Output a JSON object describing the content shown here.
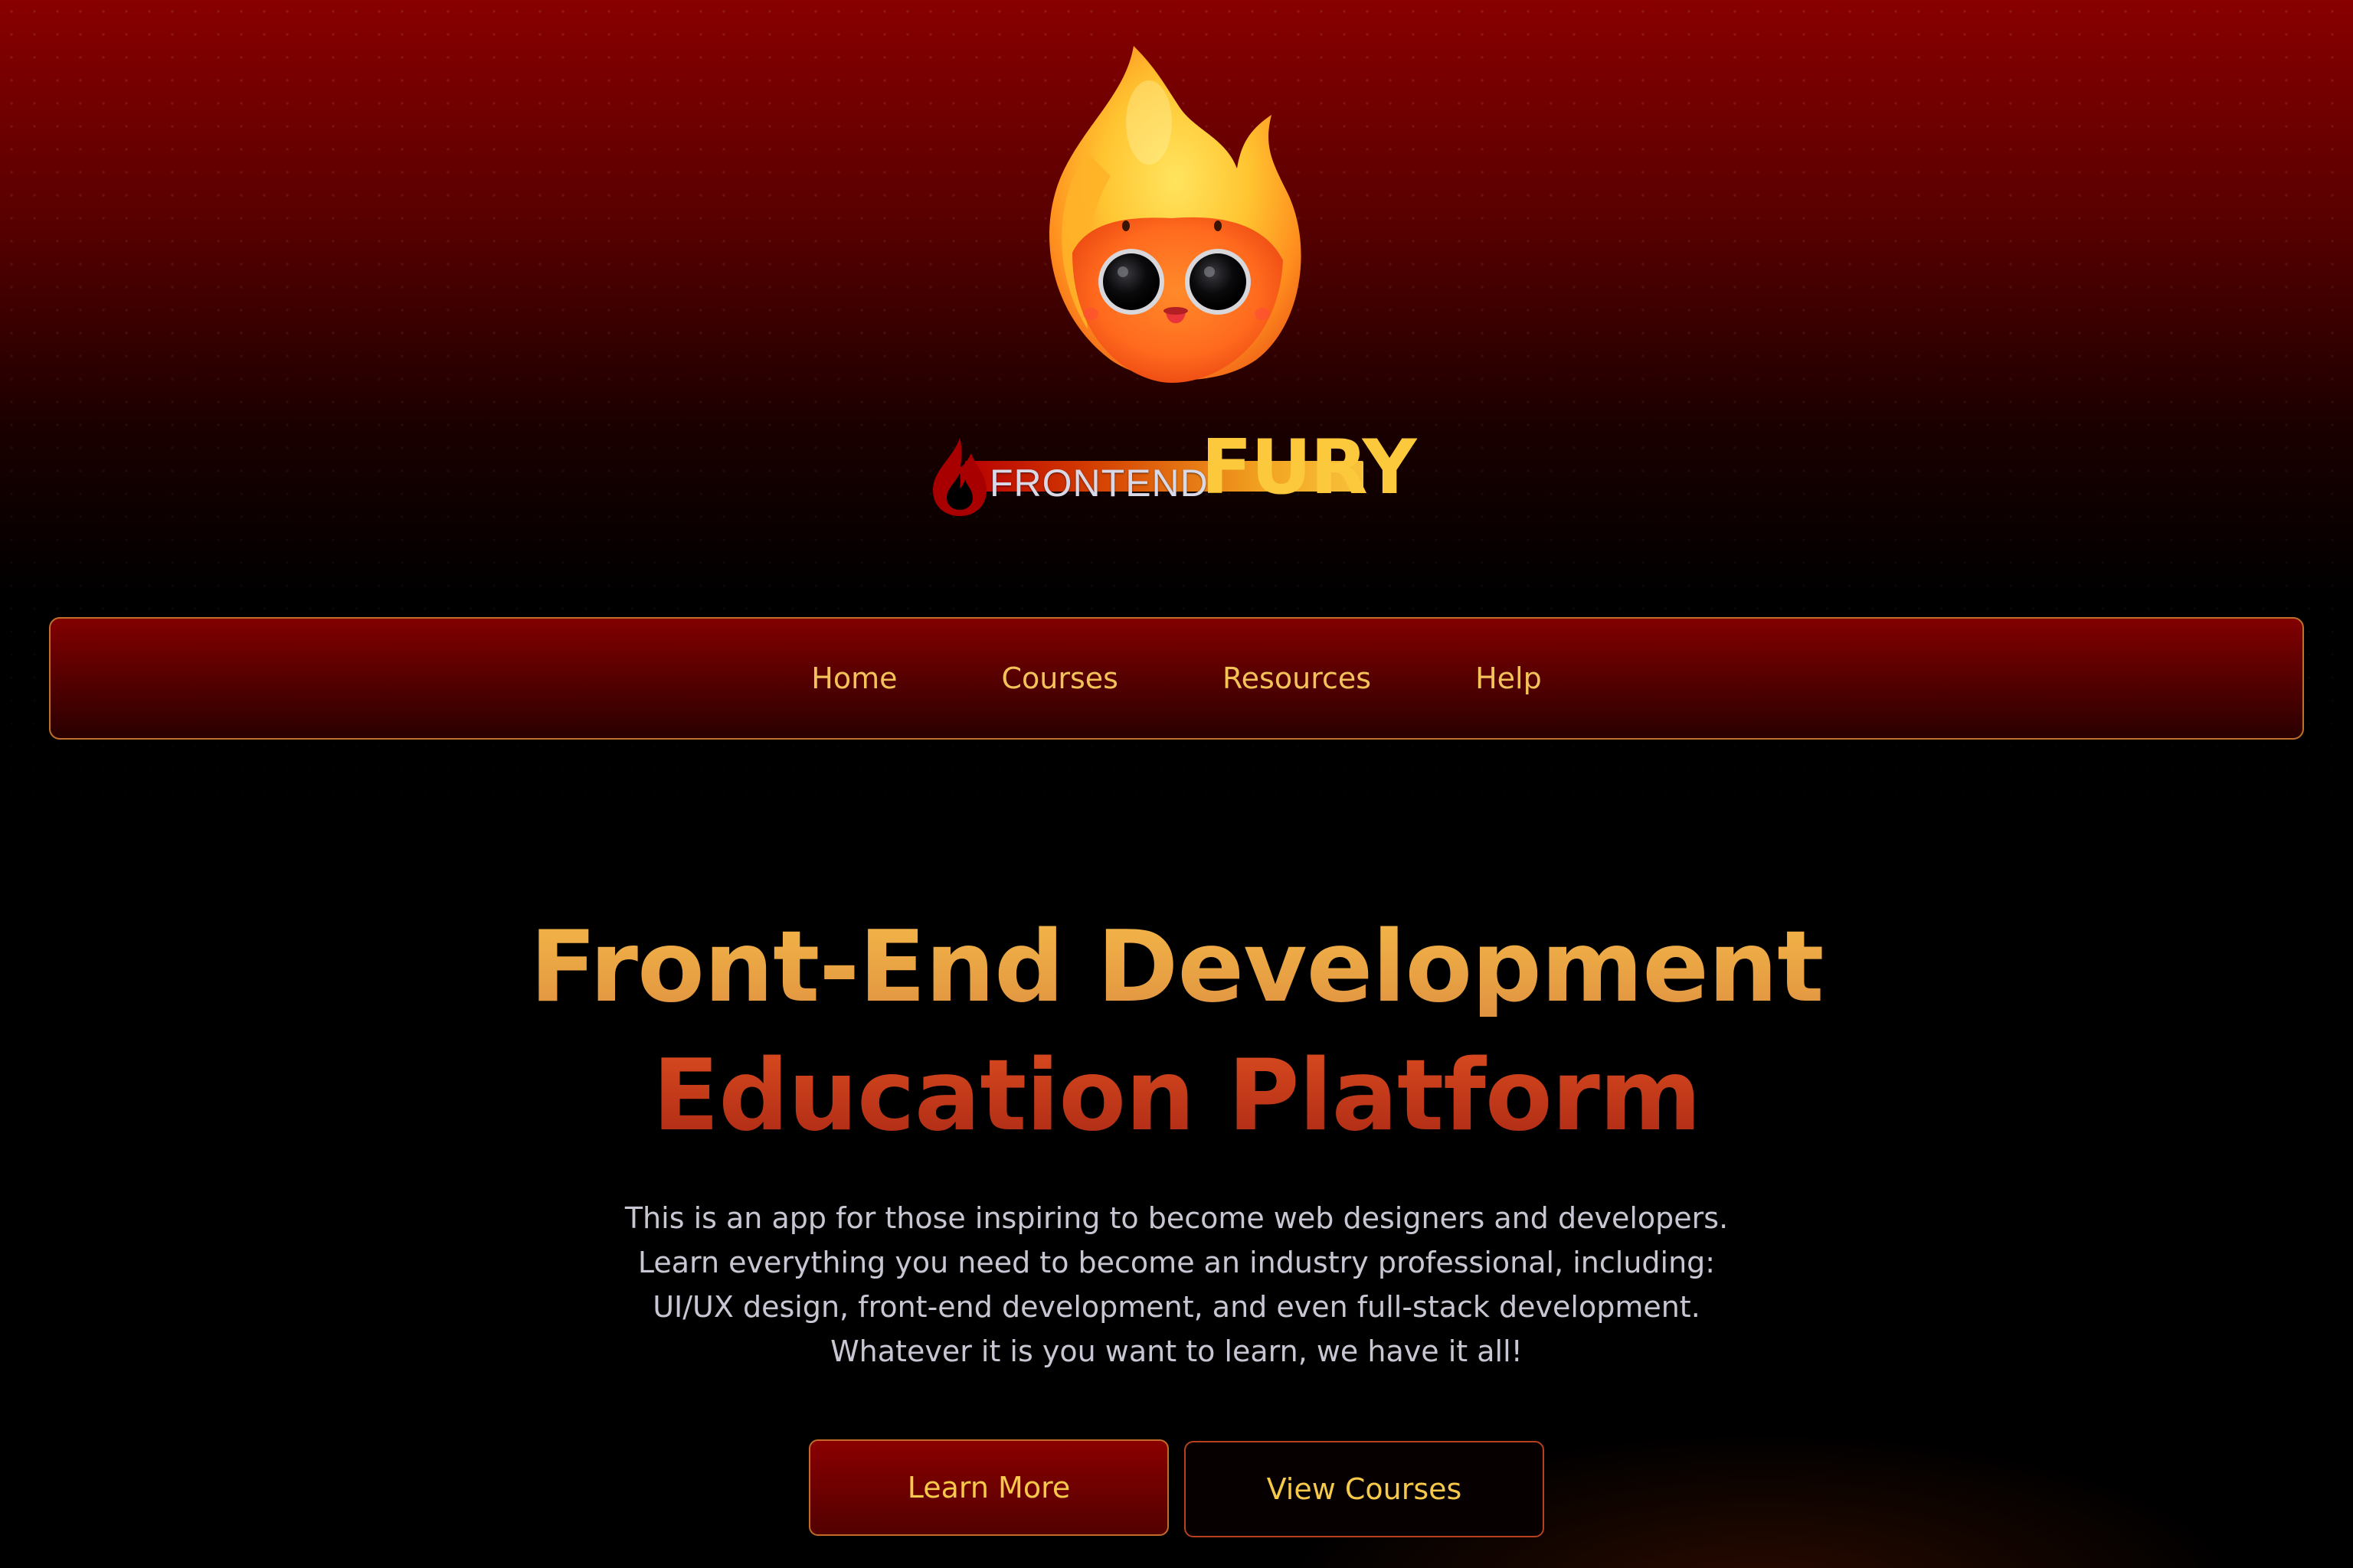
{
  "logo": {
    "prefix": "FRONTEND",
    "name": "FURY"
  },
  "mascot": {
    "icon": "flame-mascot-icon"
  },
  "nav": {
    "items": [
      {
        "label": "Home"
      },
      {
        "label": "Courses"
      },
      {
        "label": "Resources"
      },
      {
        "label": "Help"
      }
    ]
  },
  "hero": {
    "title_line1": "Front-End Development",
    "title_line2": "Education Platform",
    "description": "This is an app for those inspiring to become web designers and developers. Learn everything you need to become an industry professional, including: UI/UX design, front-end development, and even full-stack development. Whatever it is you want to learn, we have it all!",
    "primary_button": "Learn More",
    "secondary_button": "View Courses"
  },
  "colors": {
    "accent_gold": "#f3c35a",
    "accent_orange": "#eda845",
    "accent_red": "#c6381d",
    "nav_bg": "#820000",
    "page_bg": "#000000"
  }
}
